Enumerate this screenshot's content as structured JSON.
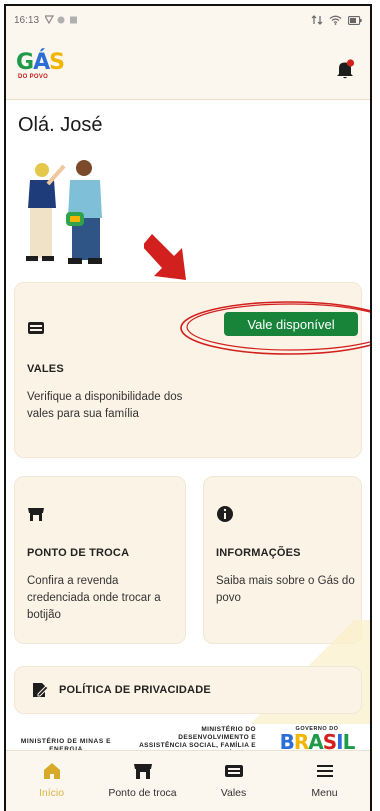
{
  "status_bar": {
    "time": "16:13"
  },
  "header": {
    "logo": {
      "brand": "GÁS",
      "brand_g": "G",
      "brand_a": "Á",
      "brand_s": "S",
      "tagline": "DO POVO"
    },
    "notification_count": ""
  },
  "greeting": "Olá. José",
  "cards": {
    "vales": {
      "badge": "Vale disponível",
      "title": "VALES",
      "desc": "Verifique a disponibilidade dos vales para sua família"
    },
    "ponto_de_troca": {
      "title": "PONTO DE TROCA",
      "desc": "Confira a revenda credenciada onde trocar a botijão"
    },
    "informacoes": {
      "title": "INFORMAÇÕES",
      "desc": "Saiba mais sobre o Gás do povo"
    },
    "privacidade": {
      "title": "POLÍTICA DE PRIVACIDADE"
    }
  },
  "footer_logos": {
    "ministerio_minas": "MINISTÉRIO DE MINAS E ENERGIA",
    "ministerio_desenvolvimento": "MINISTÉRIO DO DESENVOLVIMENTO E ASSISTÊNCIA SOCIAL, FAMÍLIA E COMBATE À FOME",
    "governo_caption": "GOVERNO DO",
    "governo_word": "BRASIL"
  },
  "bottom_nav": [
    {
      "label": "Início",
      "icon": "home-icon",
      "active": true
    },
    {
      "label": "Ponto de troca",
      "icon": "store-icon",
      "active": false
    },
    {
      "label": "Vales",
      "icon": "ticket-icon",
      "active": false
    },
    {
      "label": "Menu",
      "icon": "menu-icon",
      "active": false
    }
  ],
  "colors": {
    "accent": "#17843a",
    "active_nav": "#d9b548",
    "annotation": "#d2201f",
    "card_bg": "#fbf4e6"
  }
}
